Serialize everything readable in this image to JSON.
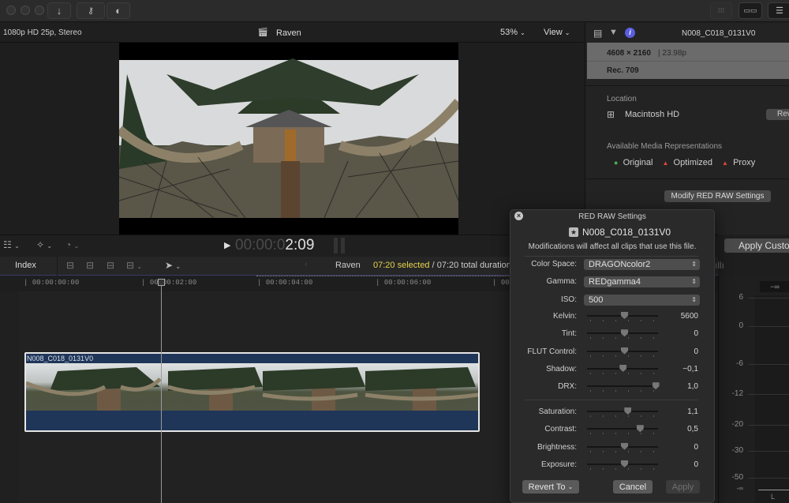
{
  "titlebar": {
    "import_icon": "arrow-down",
    "keywords_icon": "key",
    "color_icon": "half-circle",
    "layout_icons": [
      "grid-browser",
      "timeline-layout",
      "inspector-sliders"
    ]
  },
  "viewer": {
    "format": "1080p HD 25p, Stereo",
    "project_name": "Raven",
    "zoom": "53%",
    "view_label": "View",
    "timecode_dim": "00:00:0",
    "timecode_bright": "2:09"
  },
  "inspector": {
    "clip_name": "N008_C018_0131V0",
    "resolution": "4608 × 2160",
    "framerate": "| 23.98p",
    "color_space": "Rec. 709",
    "location_label": "Location",
    "location_value": "Macintosh HD",
    "reveal_label": "Rev",
    "representations_label": "Available Media Representations",
    "representations": [
      {
        "label": "Original",
        "status": "available",
        "color": "#4caf50"
      },
      {
        "label": "Optimized",
        "status": "missing",
        "color": "#e0463a"
      },
      {
        "label": "Proxy",
        "status": "missing",
        "color": "#e0463a"
      }
    ],
    "modify_button": "Modify RED RAW Settings",
    "apply_custom": "Apply Custo"
  },
  "timeline": {
    "index_label": "Index",
    "project_name": "Raven",
    "selected": "07:20 selected",
    "total": " / 07:20 total duration",
    "ruler": [
      "00:00:00:00",
      "00:00:02:00",
      "00:00:04:00",
      "00:00:06:00",
      "00"
    ],
    "clip_name": "N008_C018_0131V0"
  },
  "dialog": {
    "title": "RED RAW Settings",
    "clip_name": "N008_C018_0131V0",
    "note": "Modifications will affect all clips that use this file.",
    "popups": [
      {
        "label": "Color Space:",
        "value": "DRAGONcolor2"
      },
      {
        "label": "Gamma:",
        "value": "REDgamma4"
      },
      {
        "label": "ISO:",
        "value": "500"
      }
    ],
    "sliders_a": [
      {
        "label": "Kelvin:",
        "value": "5600",
        "pos": 0.5
      },
      {
        "label": "Tint:",
        "value": "0",
        "pos": 0.5
      },
      {
        "label": "FLUT Control:",
        "value": "0",
        "pos": 0.5
      },
      {
        "label": "Shadow:",
        "value": "−0,1",
        "pos": 0.48
      },
      {
        "label": "DRX:",
        "value": "1,0",
        "pos": 0.96
      }
    ],
    "sliders_b": [
      {
        "label": "Saturation:",
        "value": "1,1",
        "pos": 0.55
      },
      {
        "label": "Contrast:",
        "value": "0,5",
        "pos": 0.73
      },
      {
        "label": "Brightness:",
        "value": "0",
        "pos": 0.5
      },
      {
        "label": "Exposure:",
        "value": "0",
        "pos": 0.5
      }
    ],
    "revert_label": "Revert To",
    "cancel_label": "Cancel",
    "apply_label": "Apply"
  },
  "meters": {
    "peak": "−∞",
    "scale": [
      "6",
      "0",
      "-6",
      "-12",
      "-20",
      "-30",
      "-50",
      "-∞"
    ],
    "channel": "L"
  }
}
